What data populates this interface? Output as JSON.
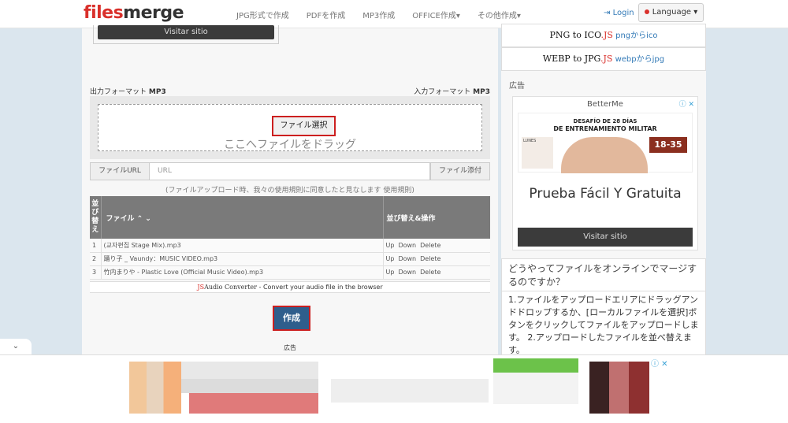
{
  "navbar": {
    "logo_files": "files",
    "logo_merge": "merge",
    "links": [
      "JPG形式で作成",
      "PDFを作成",
      "MP3作成",
      "OFFICE作成▾",
      "その他作成▾"
    ],
    "login": "Login",
    "language": "Language ▾"
  },
  "top_ad": {
    "visit_label": "Visitar sitio"
  },
  "format": {
    "output_label": "出力フォーマット",
    "output_value": "MP3",
    "input_label": "入力フォーマット",
    "input_value": "MP3"
  },
  "upload": {
    "select_button": "ファイル選択",
    "drop_text": "ここへファイルをドラッグ",
    "url_label": "ファイルURL",
    "url_placeholder": "URL",
    "attach_button": "ファイル添付",
    "terms": "(ファイルアップロード時、我々の使用規則に同意したと見なします 使用規則)"
  },
  "table": {
    "headers": {
      "sort": "並び替え",
      "file": "ファイル ⌃ ⌄",
      "ops": "並び替え&操作"
    },
    "rows": [
      {
        "index": "1",
        "name": "(교자편집 Stage Mix).mp3",
        "up": "Up",
        "down": "Down",
        "delete": "Delete"
      },
      {
        "index": "2",
        "name": "踊り子 _ Vaundy：MUSIC VIDEO.mp3",
        "up": "Up",
        "down": "Down",
        "delete": "Delete"
      },
      {
        "index": "3",
        "name": "竹内まりや - Plastic Love (Official Music Video).mp3",
        "up": "Up",
        "down": "Down",
        "delete": "Delete"
      }
    ]
  },
  "converter": {
    "js": "JS",
    "name": "Audio Converter",
    "tagline": " - Convert your audio file in the browser"
  },
  "create_button": "作成",
  "ad_label": "広告",
  "sidebar": {
    "tool1": {
      "a": "PNG",
      "to": " to ",
      "b": "ICO",
      "js": ".JS",
      "ja": " pngからico"
    },
    "tool2": {
      "a": "WEBP",
      "to": " to ",
      "b": "JPG",
      "js": ".JS",
      "ja": " webpからjpg"
    },
    "ad_label": "広告",
    "ad": {
      "brand": "BetterMe",
      "line1": "DESAFÍO DE 28 DÍAS",
      "line2": "DE ENTRENAMIENTO MILITAR",
      "age": "18-35",
      "day": "LUNES",
      "headline": "Prueba Fácil Y Gratuita",
      "visit": "Visitar sitio"
    },
    "howto_title": "どうやってファイルをオンラインでマージするのですか？",
    "howto_body": "1.ファイルをアップロードエリアにドラッグアンドドロップするか、[ローカルファイルを選択]ボタンをクリックしてファイルをアップロードします。 2.アップロードしたファイルを並べ替えます。"
  },
  "collapse_tab": "⌄",
  "colors": {
    "accent": "#d9302b",
    "create_button": "#2f5e8c",
    "link": "#337ab7"
  }
}
